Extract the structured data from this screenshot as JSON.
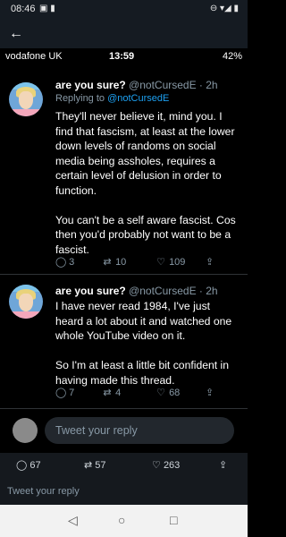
{
  "phone_status": {
    "time": "08:46",
    "left_icons": "▣ ▮",
    "right_icons": "⊖ ▾◢ ▮"
  },
  "screenshot": {
    "status": {
      "carrier": "vodafone UK",
      "time": "13:59",
      "battery": "42%"
    },
    "tweets": [
      {
        "name": "are you sure?",
        "handle": "@notCursedE · 2h",
        "replying_prefix": "Replying to ",
        "replying_to": "@notCursedE",
        "text": "They'll never believe it, mind you. I find that fascism, at least at the lower down levels of randoms on social media being assholes, requires a certain level of delusion in order to function.\n\nYou can't be a self aware fascist. Cos then you'd probably not want to be a fascist.",
        "replies": "3",
        "retweets": "10",
        "likes": "109"
      },
      {
        "name": "are you sure?",
        "handle": "@notCursedE · 2h",
        "text": "I have never read 1984, I've just heard a lot about it and watched one whole YouTube video on it.\n\nSo I'm at least a little bit confident in having made this thread.",
        "replies": "7",
        "retweets": "4",
        "likes": "68"
      }
    ]
  },
  "reply_box": {
    "placeholder": "Tweet your reply"
  },
  "stats": {
    "comments": "67",
    "retweets": "57",
    "likes": "263"
  },
  "bottom_reply": "Tweet your reply",
  "icons": {
    "back": "←",
    "reply": "◯",
    "retweet": "⇄",
    "like": "♡",
    "share": "⇪",
    "nav_back": "◁",
    "nav_home": "○",
    "nav_recent": "□"
  }
}
